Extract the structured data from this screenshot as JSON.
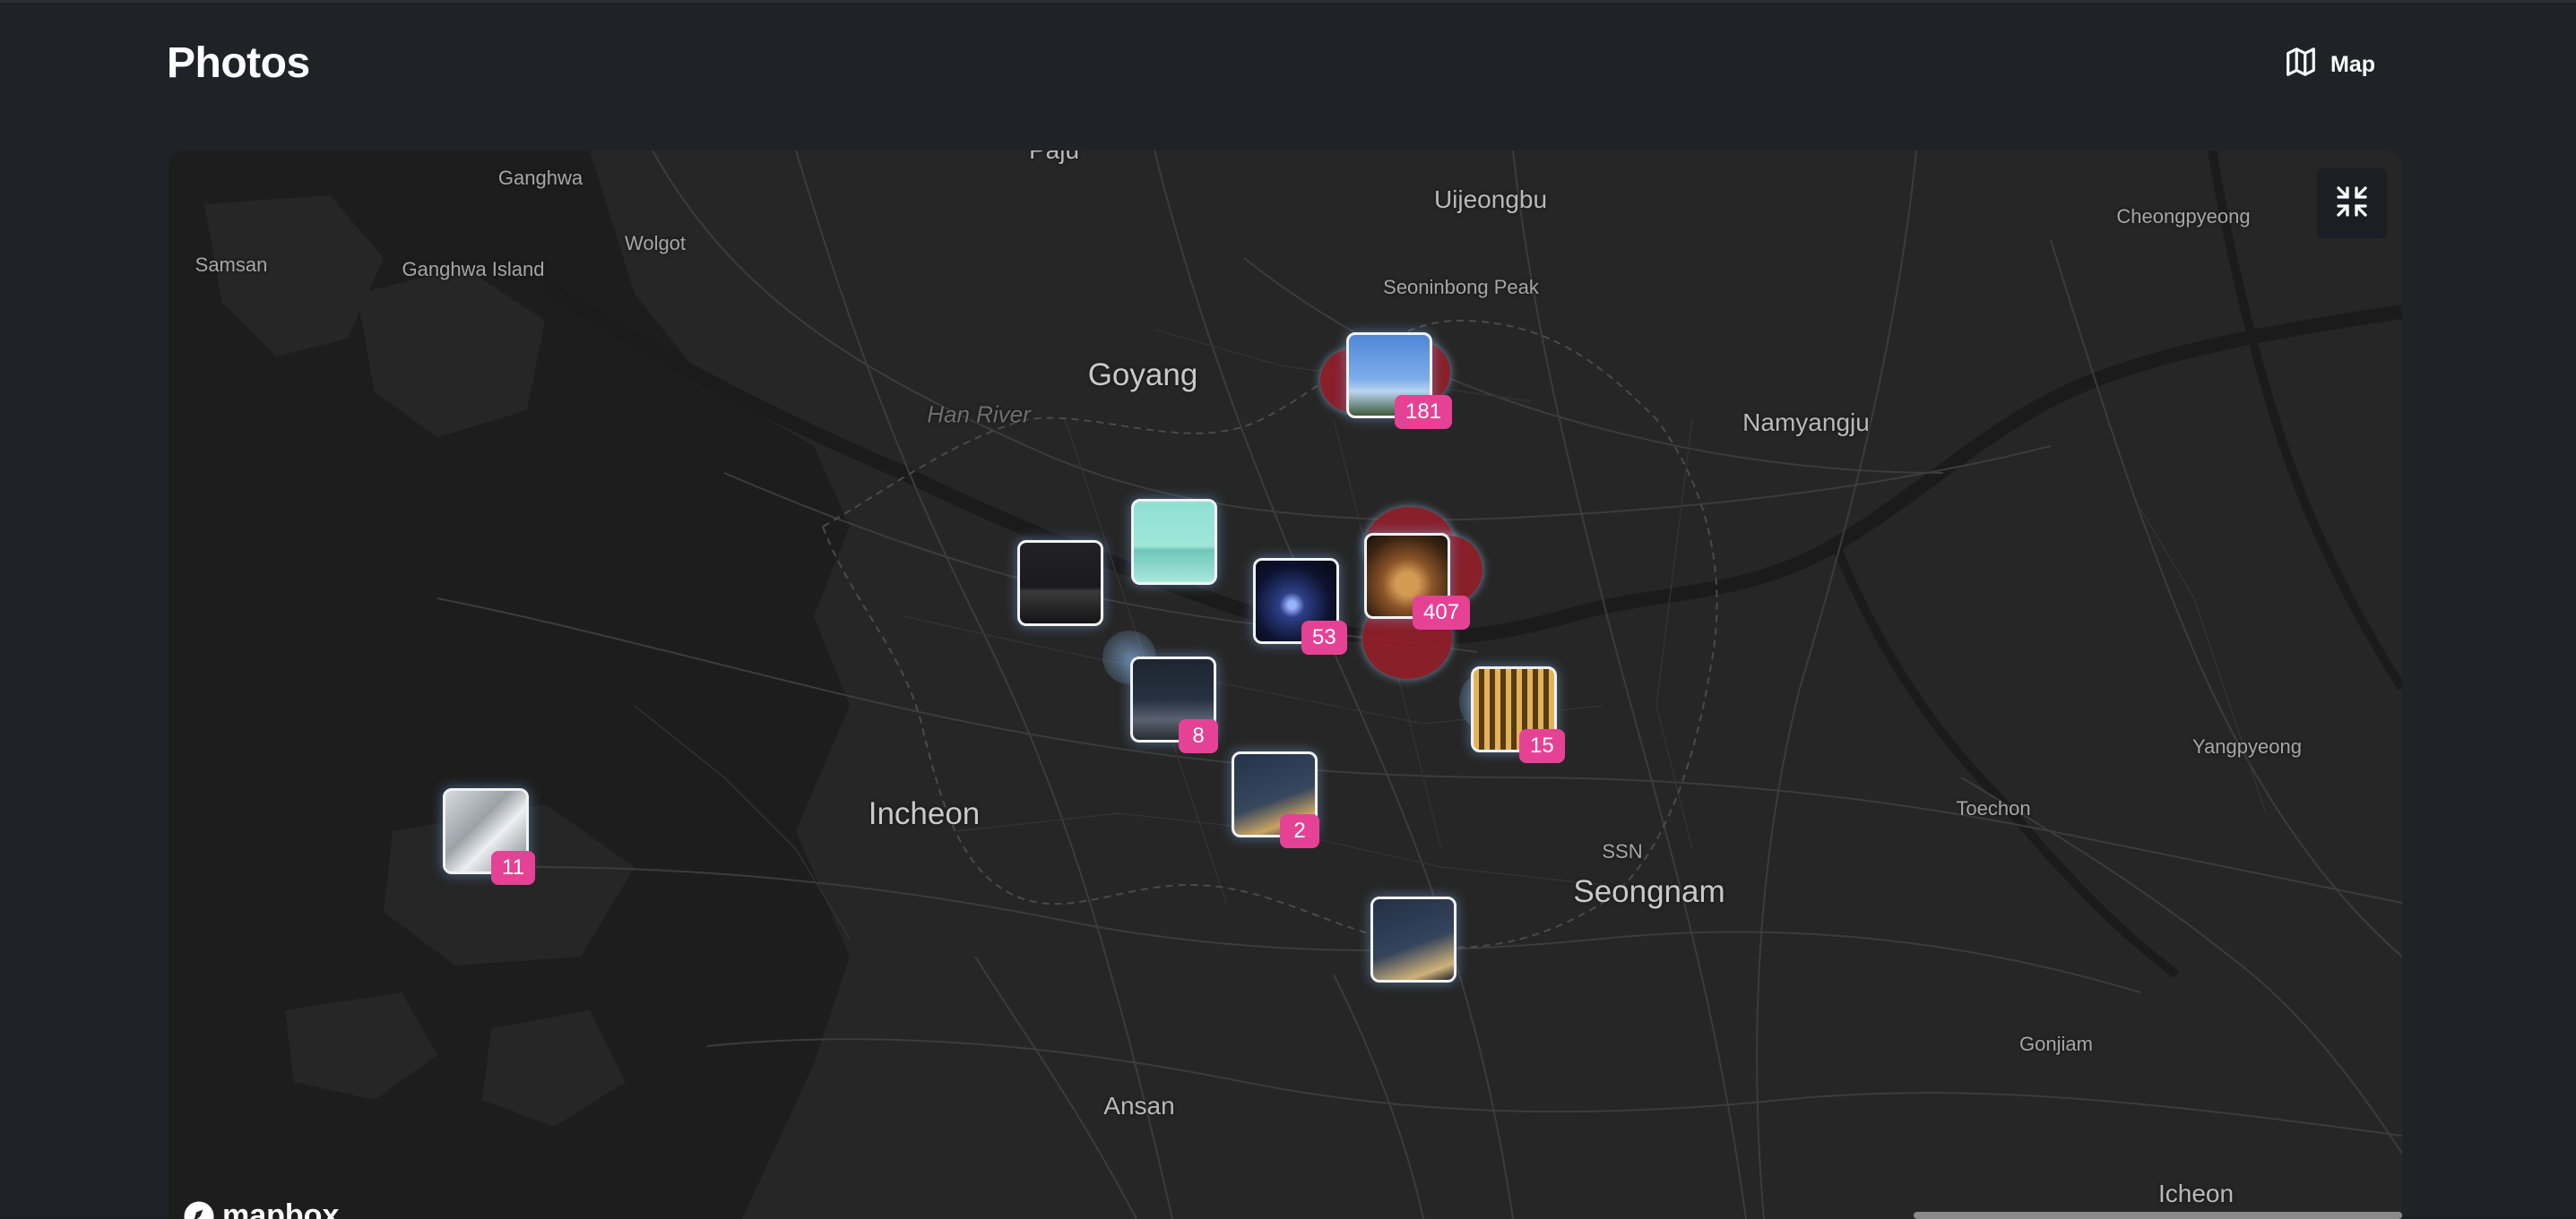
{
  "header": {
    "title": "Photos",
    "map_button_label": "Map"
  },
  "map": {
    "places": [
      {
        "id": "paju",
        "name": "Paju",
        "size": "mid"
      },
      {
        "id": "ganghwa",
        "name": "Ganghwa",
        "size": "small"
      },
      {
        "id": "uijeongbu",
        "name": "Uijeongbu",
        "size": "mid"
      },
      {
        "id": "cheongpyeong",
        "name": "Cheongpyeong",
        "size": "small"
      },
      {
        "id": "samsan",
        "name": "Samsan",
        "size": "small"
      },
      {
        "id": "ganghwa-island",
        "name": "Ganghwa Island",
        "size": "small"
      },
      {
        "id": "wolgot",
        "name": "Wolgot",
        "size": "small"
      },
      {
        "id": "seoninbong",
        "name": "Seoninbong Peak",
        "size": "small"
      },
      {
        "id": "goyang",
        "name": "Goyang",
        "size": "big"
      },
      {
        "id": "han-river",
        "name": "Han River",
        "size": "water"
      },
      {
        "id": "namyangju",
        "name": "Namyangju",
        "size": "mid"
      },
      {
        "id": "incheon",
        "name": "Incheon",
        "size": "big"
      },
      {
        "id": "ssn",
        "name": "SSN",
        "size": "small"
      },
      {
        "id": "seongnam",
        "name": "Seongnam",
        "size": "big"
      },
      {
        "id": "yangpyeong",
        "name": "Yangpyeong",
        "size": "small"
      },
      {
        "id": "toechon",
        "name": "Toechon",
        "size": "small"
      },
      {
        "id": "gonjiam",
        "name": "Gonjiam",
        "size": "small"
      },
      {
        "id": "ansan",
        "name": "Ansan",
        "size": "mid"
      },
      {
        "id": "icheon",
        "name": "Icheon",
        "size": "mid"
      }
    ],
    "clusters": [
      {
        "id": "c181",
        "count": "181",
        "thumb": "sky"
      },
      {
        "id": "c-single-1",
        "count": "",
        "thumb": "night"
      },
      {
        "id": "c-single-2",
        "count": "",
        "thumb": "teal"
      },
      {
        "id": "c53",
        "count": "53",
        "thumb": "lights"
      },
      {
        "id": "c407",
        "count": "407",
        "thumb": "tree"
      },
      {
        "id": "c8",
        "count": "8",
        "thumb": "city"
      },
      {
        "id": "c15",
        "count": "15",
        "thumb": "building"
      },
      {
        "id": "c2",
        "count": "2",
        "thumb": "dusk"
      },
      {
        "id": "c11",
        "count": "11",
        "thumb": "grey"
      },
      {
        "id": "c-single-3",
        "count": "",
        "thumb": "dusk"
      }
    ],
    "attribution": "mapbox",
    "fullscreen_icon": "collapse-icon"
  },
  "colors": {
    "count_badge": "#e64295",
    "cluster_halo": "#8f1f2a"
  }
}
